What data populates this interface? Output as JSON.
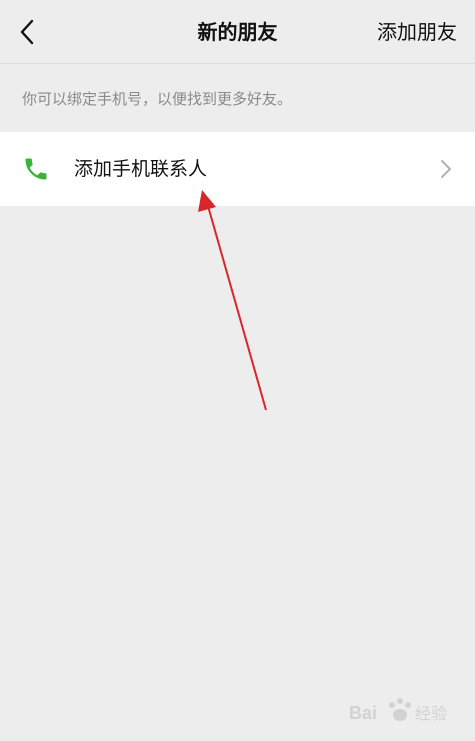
{
  "header": {
    "title": "新的朋友",
    "action_label": "添加朋友"
  },
  "hint": {
    "text": "你可以绑定手机号，以便找到更多好友。"
  },
  "list": {
    "items": [
      {
        "label": "添加手机联系人",
        "icon": "phone-icon"
      }
    ]
  },
  "colors": {
    "background": "#ededed",
    "phone_icon": "#3cb23c",
    "annotation_arrow": "#d9262b"
  },
  "watermark": {
    "text": "Bai 经验"
  }
}
